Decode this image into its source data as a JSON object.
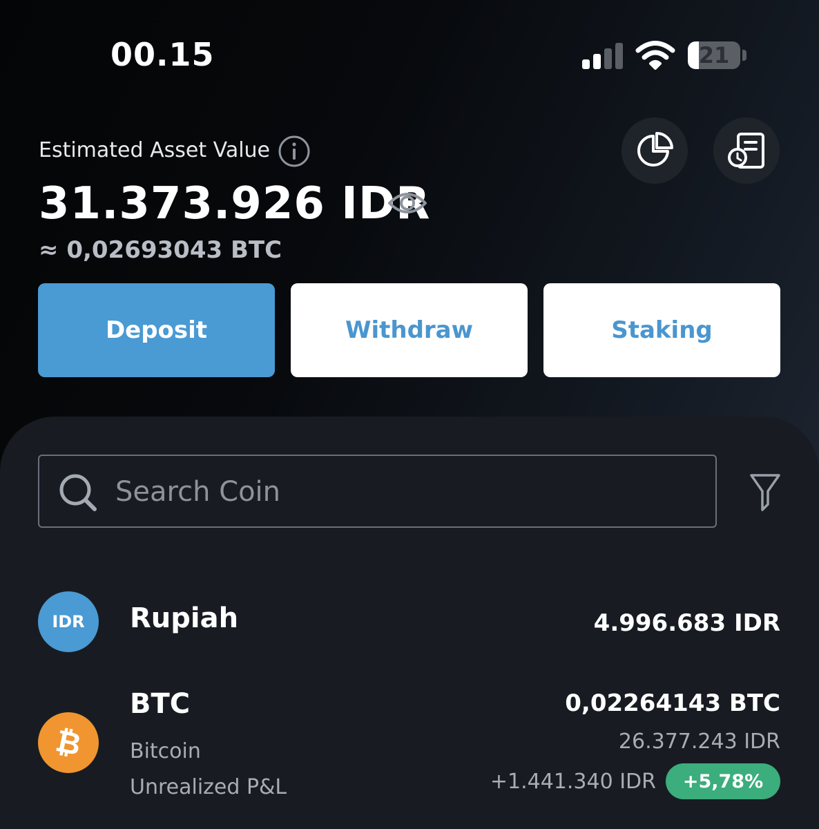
{
  "status_bar": {
    "time": "00.15",
    "battery_percent": "21",
    "battery_level": 0.21,
    "signal_bars_active": 2,
    "signal_bars_total": 4
  },
  "header": {
    "estimated_label": "Estimated Asset Value",
    "asset_value": "31.373.926 IDR",
    "btc_equivalent": "≈ 0,02693043 BTC",
    "icons": {
      "info": "info-icon",
      "eye": "eye-icon",
      "pie": "pie-chart-icon",
      "report": "report-history-icon"
    }
  },
  "actions": {
    "deposit": "Deposit",
    "withdraw": "Withdraw",
    "staking": "Staking"
  },
  "search": {
    "placeholder": "Search Coin",
    "value": ""
  },
  "assets": [
    {
      "avatar_text": "IDR",
      "name": "Rupiah",
      "amount": "4.996.683 IDR"
    },
    {
      "avatar_symbol": "₿",
      "name": "BTC",
      "full_name": "Bitcoin",
      "pnl_label": "Unrealized P&L",
      "amount": "0,02264143 BTC",
      "idr_value": "26.377.243 IDR",
      "pnl_value": "+1.441.340 IDR",
      "pnl_percent": "+5,78%"
    }
  ],
  "colors": {
    "accent_blue": "#4a9ad3",
    "button_text_blue": "#4a96cf",
    "profit_green": "#3cad7c",
    "bitcoin_orange": "#f0952f",
    "panel_bg": "#181c22"
  }
}
